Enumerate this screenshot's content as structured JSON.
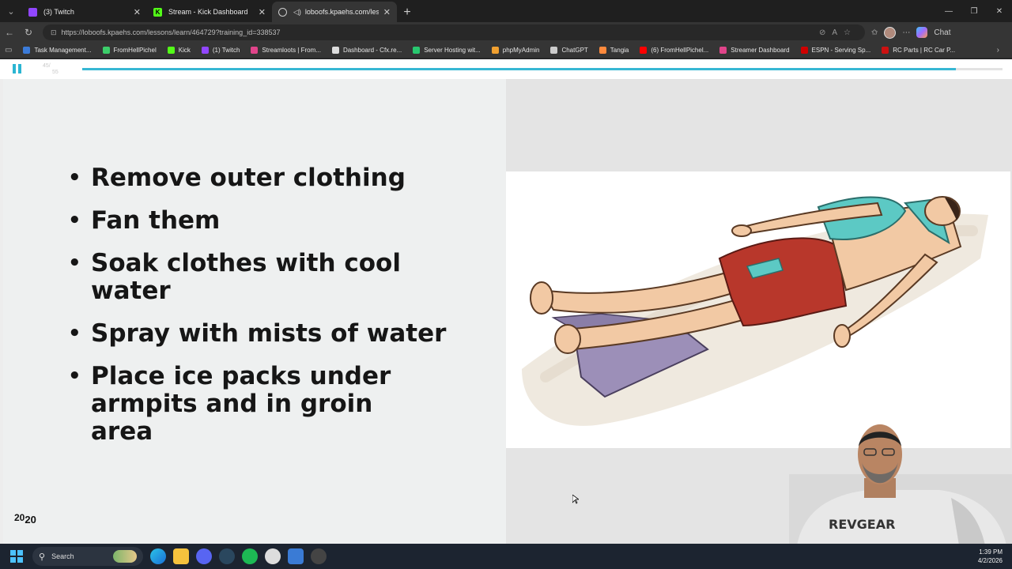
{
  "browser": {
    "tabs": [
      {
        "label": "(3) Twitch",
        "favicon_color": "#9146ff",
        "active": false
      },
      {
        "label": "Stream - Kick Dashboard",
        "favicon_color": "#53fc18",
        "favicon_letter": "K",
        "active": false
      },
      {
        "label": "loboofs.kpaehs.com/lessons/l",
        "favicon_color": "#cccccc",
        "active": true
      }
    ],
    "url": "https://loboofs.kpaehs.com/lessons/learn/464729?training_id=338537",
    "chat_label": "Chat"
  },
  "bookmarks": [
    {
      "label": "Task Management...",
      "color": "#3b7bd8"
    },
    {
      "label": "FromHellPichel",
      "color": "#3ccd6a"
    },
    {
      "label": "Kick",
      "color": "#53fc18"
    },
    {
      "label": "(1) Twitch",
      "color": "#9146ff"
    },
    {
      "label": "Streamloots | From...",
      "color": "#e0448a"
    },
    {
      "label": "Dashboard - Cfx.re...",
      "color": "#dddddd"
    },
    {
      "label": "Server Hosting wit...",
      "color": "#28c76f"
    },
    {
      "label": "phpMyAdmin",
      "color": "#f0a030"
    },
    {
      "label": "ChatGPT",
      "color": "#cccccc"
    },
    {
      "label": "Tangia",
      "color": "#ff8a3d"
    },
    {
      "label": "(6) FromHellPichel...",
      "color": "#ff0000"
    },
    {
      "label": "Streamer Dashboard",
      "color": "#e0448a"
    },
    {
      "label": "ESPN - Serving Sp...",
      "color": "#d00000"
    },
    {
      "label": "RC Parts | RC Car P...",
      "color": "#cc1111"
    }
  ],
  "player": {
    "counter_top": "45",
    "counter_bottom": "55",
    "progress_fraction": 0.949,
    "accent": "#37b7d3"
  },
  "slide": {
    "bullets": [
      "Remove outer clothing",
      "Fan them",
      "Soak clothes with cool water",
      "Spray with mists of water",
      "Place ice packs under armpits and in groin area"
    ],
    "logo_main": "20",
    "logo_sub": "20"
  },
  "webcam": {
    "shirt_text": "REVGEAR"
  },
  "taskbar": {
    "search_label": "Search",
    "time": "1:39 PM",
    "date": "4/2/2026"
  }
}
